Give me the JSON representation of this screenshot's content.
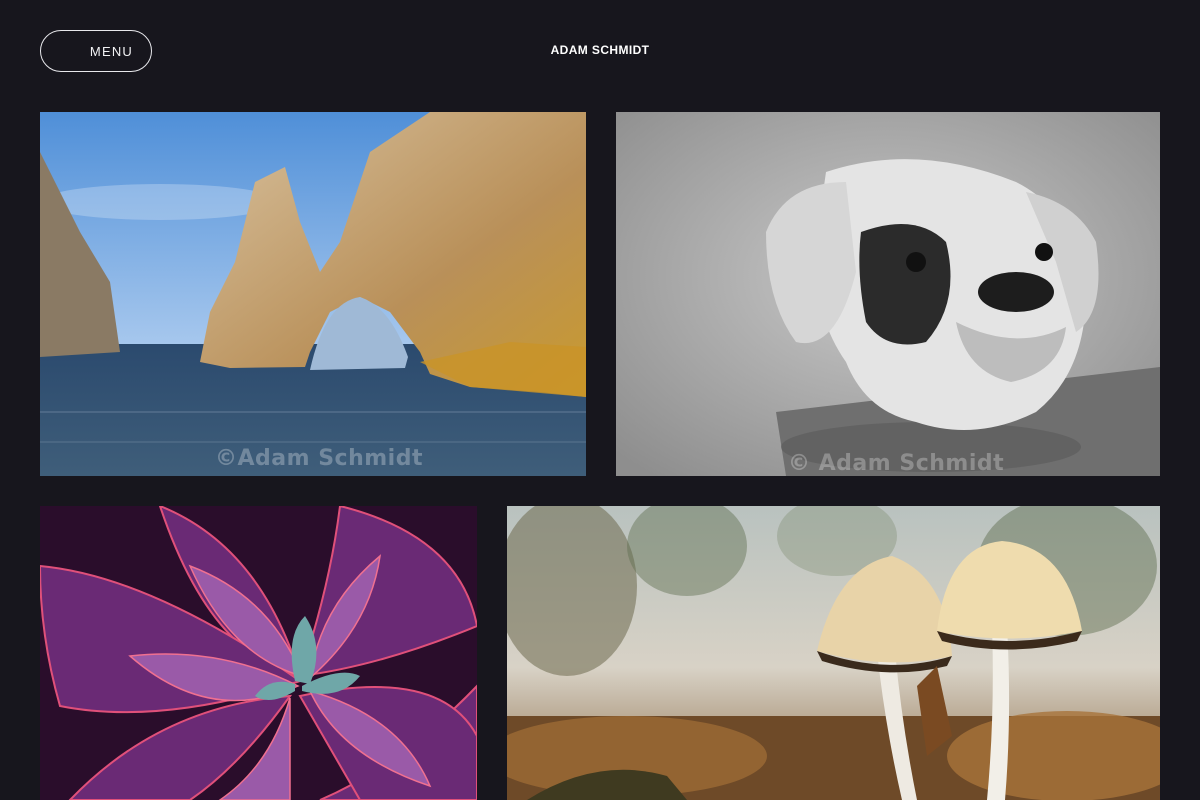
{
  "header": {
    "menu_label": "MENU",
    "site_title": "ADAM SCHMIDT"
  },
  "gallery": {
    "items": [
      {
        "subject": "El Arco rock arch over ocean",
        "watermark": "©Adam Schmidt"
      },
      {
        "subject": "Black and white boxer dog portrait",
        "watermark": "© Adam Schmidt"
      },
      {
        "subject": "Purple succulent close-up",
        "watermark": ""
      },
      {
        "subject": "Two mushrooms on forest floor",
        "watermark": ""
      }
    ]
  },
  "colors": {
    "background": "#17161d",
    "text": "#ffffff",
    "menu_border": "#e8e8ec"
  }
}
